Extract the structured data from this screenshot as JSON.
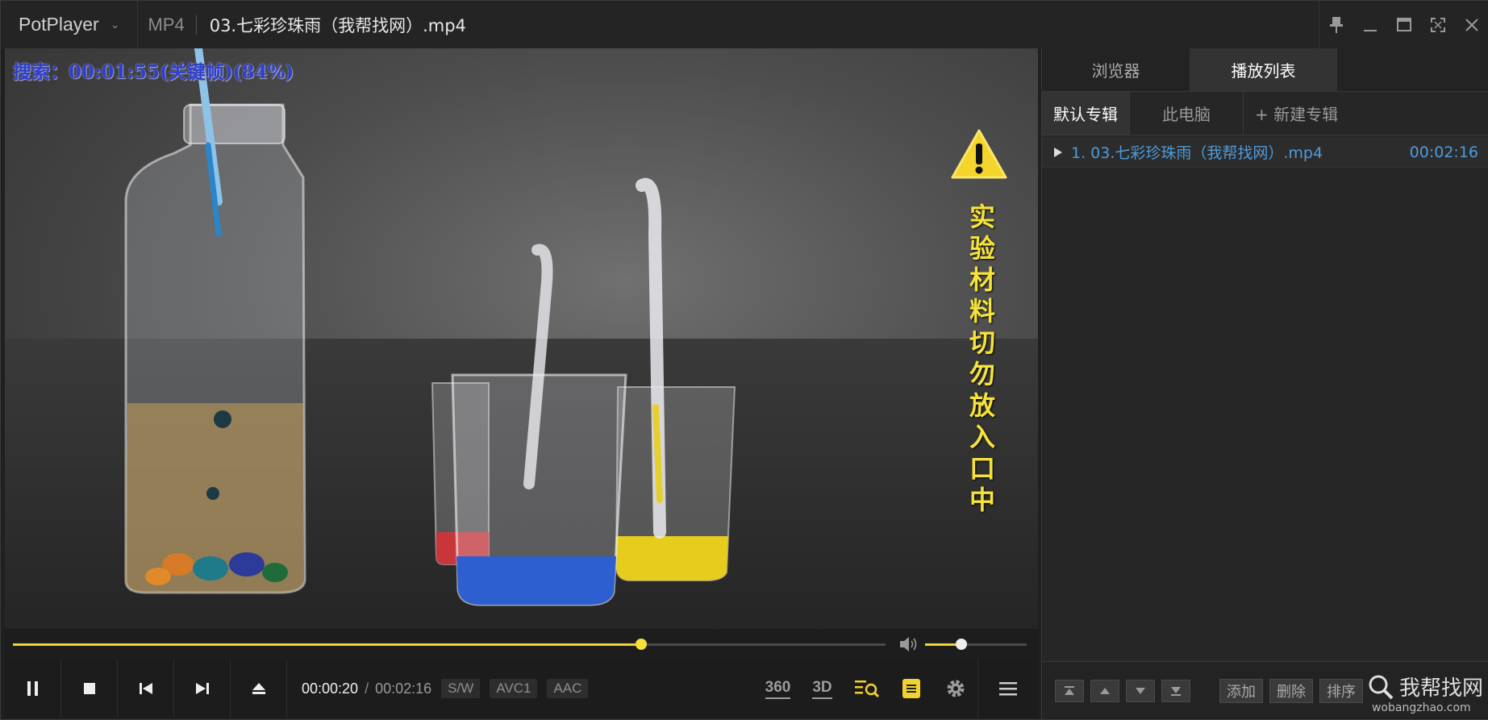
{
  "window": {
    "app_name": "PotPlayer",
    "format": "MP4",
    "title": "03.七彩珍珠雨（我帮找网）.mp4"
  },
  "video": {
    "osd_text": "搜索：00:01:55(关键帧)(84%)",
    "overlay_text": [
      "实",
      "验",
      "材",
      "料",
      "切",
      "勿",
      "放",
      "入",
      "口",
      "中"
    ]
  },
  "playback": {
    "current_time": "00:00:20",
    "separator": "/",
    "duration": "00:02:16",
    "progress": 0.72,
    "volume": 0.36,
    "tags": [
      "S/W",
      "AVC1",
      "AAC"
    ],
    "right_controls": {
      "vr_label": "360",
      "stereo_label": "3D"
    }
  },
  "panel": {
    "tabs": [
      {
        "label": "浏览器"
      },
      {
        "label": "播放列表"
      }
    ],
    "subtabs": [
      {
        "label": "默认专辑"
      },
      {
        "label": "此电脑"
      },
      {
        "label": "+ 新建专辑"
      }
    ],
    "playlist": [
      {
        "title": "1. 03.七彩珍珠雨（我帮找网）.mp4",
        "duration": "00:02:16"
      }
    ],
    "footer_buttons": {
      "add": "添加",
      "delete": "删除",
      "sort": "排序"
    }
  },
  "watermark": {
    "text": "我帮找网",
    "url": "wobangzhao.com"
  },
  "colors": {
    "accent": "#f2d230",
    "playlist_text": "#4e9bdb",
    "osd": "#2d3fd0"
  }
}
